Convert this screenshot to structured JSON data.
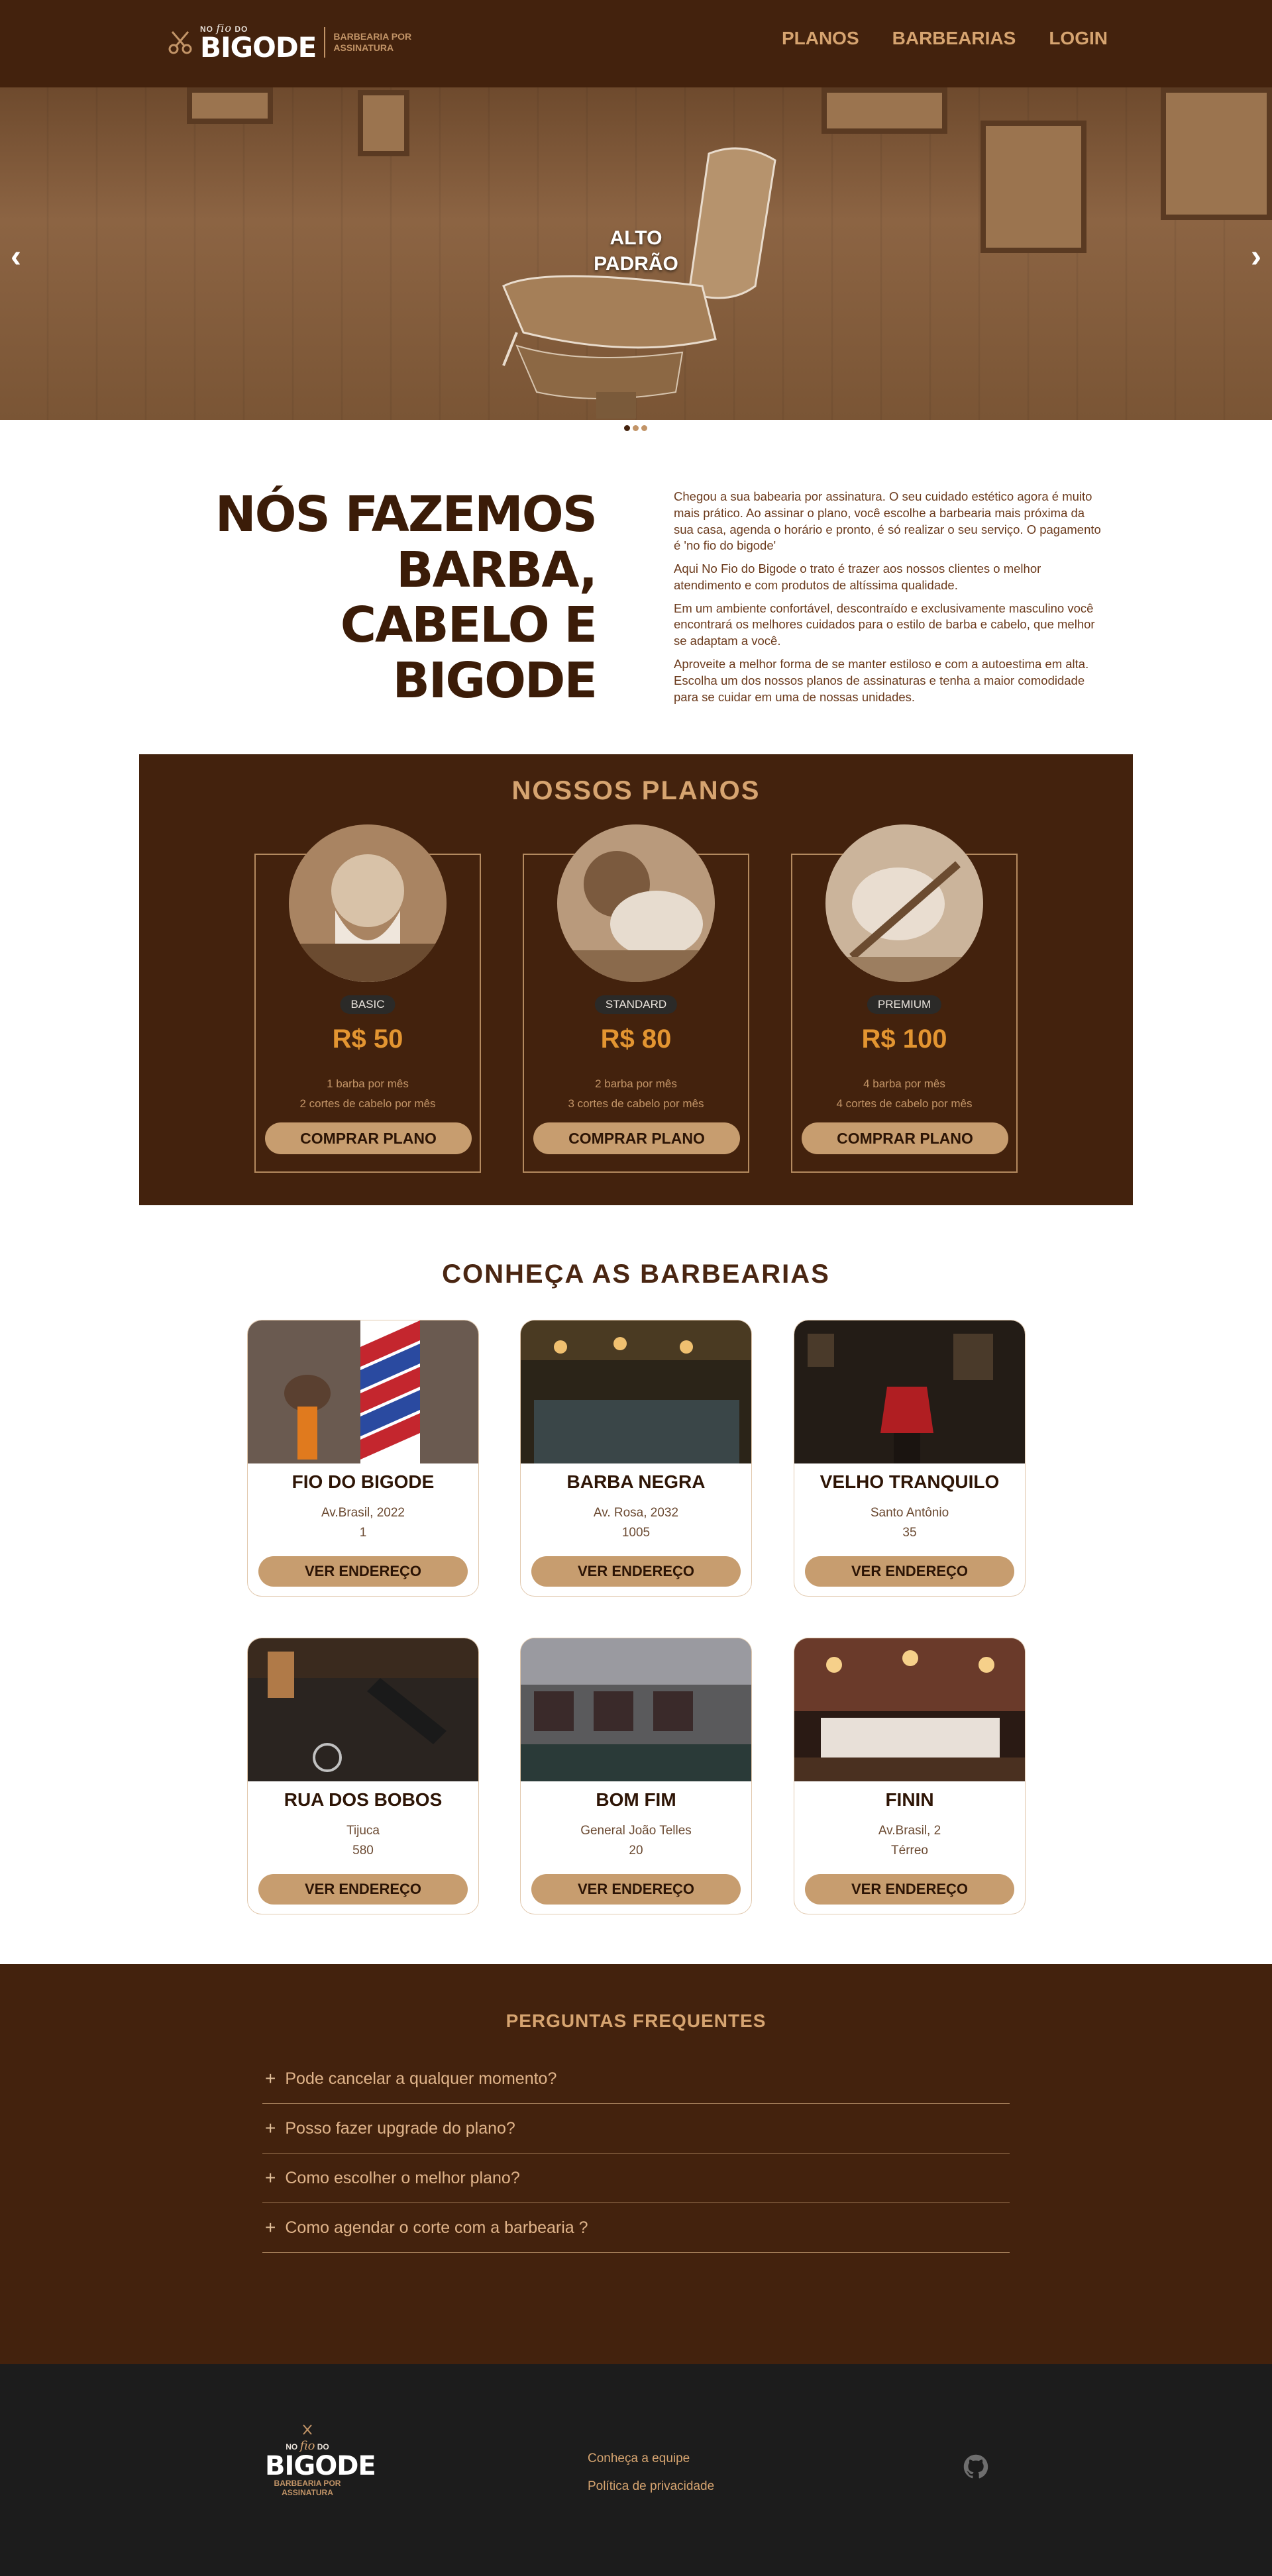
{
  "header": {
    "logo_small": "NO",
    "logo_script": "fio",
    "logo_small2": "DO",
    "logo_big": "BIGODE",
    "logo_tag": "BARBEARIA POR ASSINATURA",
    "nav": [
      "PLANOS",
      "BARBEARIAS",
      "LOGIN"
    ]
  },
  "hero": {
    "text_line1": "ALTO",
    "text_line2": "PADRÃO",
    "prev": "‹",
    "next": "›"
  },
  "intro": {
    "title_line1": "NÓS FAZEMOS BARBA,",
    "title_line2": "CABELO E BIGODE",
    "paragraphs": [
      "Chegou a sua babearia por assinatura. O seu cuidado estético agora é muito mais prático. Ao assinar o plano, você escolhe a barbearia mais próxima da sua casa, agenda o horário e pronto, é só realizar o seu serviço. O pagamento é 'no fio do bigode'",
      "Aqui No Fio do Bigode o trato é trazer aos nossos clientes o melhor atendimento e com produtos de altíssima qualidade.",
      "Em um ambiente confortável, descontraído e exclusivamente masculino você encontrará os melhores cuidados para o estilo de barba e cabelo, que melhor se adaptam a você.",
      "Aproveite a melhor forma de se manter estiloso e com a autoestima em alta. Escolha um dos nossos planos de assinaturas e tenha a maior comodidade para se cuidar em uma de nossas unidades."
    ]
  },
  "plans": {
    "title": "NOSSOS PLANOS",
    "items": [
      {
        "badge": "BASIC",
        "price": "R$ 50",
        "line1": "1 barba por mês",
        "line2": "2 cortes de cabelo por mês",
        "button": "COMPRAR PLANO"
      },
      {
        "badge": "STANDARD",
        "price": "R$ 80",
        "line1": "2 barba por mês",
        "line2": "3 cortes de cabelo por mês",
        "button": "COMPRAR PLANO"
      },
      {
        "badge": "PREMIUM",
        "price": "R$ 100",
        "line1": "4 barba por mês",
        "line2": "4 cortes de cabelo por mês",
        "button": "COMPRAR PLANO"
      }
    ]
  },
  "shops": {
    "title": "CONHEÇA AS BARBEARIAS",
    "items": [
      {
        "name": "FIO DO BIGODE",
        "addr1": "Av.Brasil, 2022",
        "addr2": "1",
        "button": "VER ENDEREÇO"
      },
      {
        "name": "BARBA NEGRA",
        "addr1": "Av. Rosa, 2032",
        "addr2": "1005",
        "button": "VER ENDEREÇO"
      },
      {
        "name": "VELHO TRANQUILO",
        "addr1": "Santo Antônio",
        "addr2": "35",
        "button": "VER ENDEREÇO"
      },
      {
        "name": "RUA DOS BOBOS",
        "addr1": "Tijuca",
        "addr2": "580",
        "button": "VER ENDEREÇO"
      },
      {
        "name": "BOM FIM",
        "addr1": "General João Telles",
        "addr2": "20",
        "button": "VER ENDEREÇO"
      },
      {
        "name": "FININ",
        "addr1": "Av.Brasil, 2",
        "addr2": "Térreo",
        "button": "VER ENDEREÇO"
      }
    ]
  },
  "faq": {
    "title": "PERGUNTAS FREQUENTES",
    "items": [
      "Pode cancelar a qualquer momento?",
      "Posso fazer upgrade do plano?",
      "Como escolher o melhor plano?",
      "Como agendar o corte com a barbearia ?"
    ]
  },
  "footer": {
    "logo_small": "NO",
    "logo_script": "fio",
    "logo_small2": "DO",
    "logo_big": "BIGODE",
    "logo_tag1": "BARBEARIA POR",
    "logo_tag2": "ASSINATURA",
    "links": [
      "Conheça a equipe",
      "Política de privacidade"
    ],
    "github_icon": "github-icon"
  },
  "colors": {
    "brown_dark": "#43220d",
    "accent": "#d6a470",
    "button": "#c79d6f",
    "price": "#e39531",
    "footer_bg": "#1c1c1c"
  }
}
